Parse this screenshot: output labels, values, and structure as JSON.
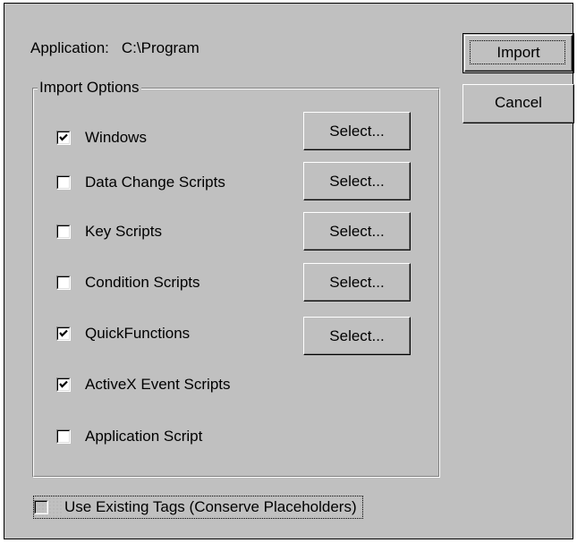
{
  "dialog": {
    "application_label": "Application:",
    "application_value": "C:\\Program",
    "group_label": "Import Options",
    "select_label": "Select...",
    "import_label": "Import",
    "cancel_label": "Cancel",
    "options": [
      {
        "label": "Windows",
        "checked": true
      },
      {
        "label": "Data Change Scripts",
        "checked": false
      },
      {
        "label": "Key Scripts",
        "checked": false
      },
      {
        "label": "Condition Scripts",
        "checked": false
      },
      {
        "label": "QuickFunctions",
        "checked": true
      },
      {
        "label": "ActiveX Event Scripts",
        "checked": true
      },
      {
        "label": "Application Script",
        "checked": false
      }
    ],
    "conserve": {
      "label": "Use Existing Tags (Conserve Placeholders)",
      "checked": false
    }
  }
}
